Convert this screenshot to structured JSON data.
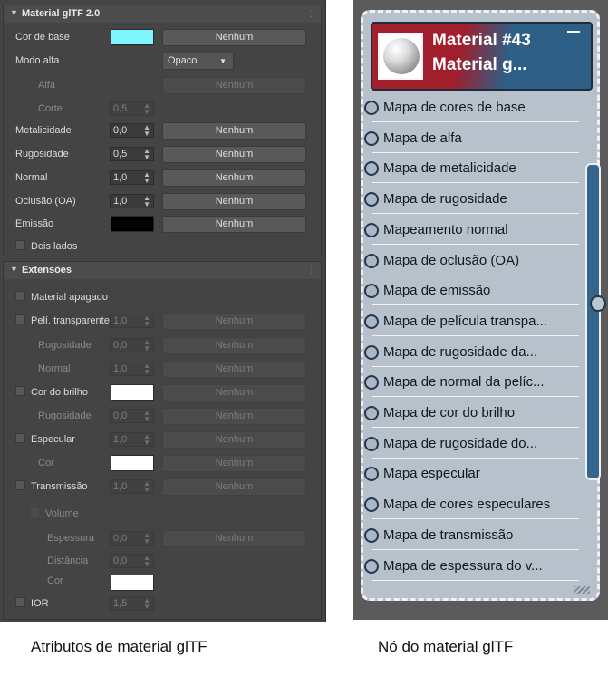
{
  "panel": {
    "gltf_section": {
      "title": "Material glTF 2.0",
      "rows": {
        "base_color": {
          "label": "Cor de base",
          "color": "#7ff6ff",
          "map": "Nenhum"
        },
        "alpha_mode": {
          "label": "Modo alfa",
          "value": "Opaco"
        },
        "alpha": {
          "label": "Alfa",
          "map": "Nenhum"
        },
        "cutoff": {
          "label": "Corte",
          "value": "0,5"
        },
        "metalness": {
          "label": "Metalicidade",
          "value": "0,0",
          "map": "Nenhum"
        },
        "roughness": {
          "label": "Rugosidade",
          "value": "0,5",
          "map": "Nenhum"
        },
        "normal": {
          "label": "Normal",
          "value": "1,0",
          "map": "Nenhum"
        },
        "occlusion": {
          "label": "Oclusão (OA)",
          "value": "1,0",
          "map": "Nenhum"
        },
        "emission": {
          "label": "Emissão",
          "color": "#000000",
          "map": "Nenhum"
        },
        "double_sided": {
          "label": "Dois lados"
        }
      }
    },
    "extensions_section": {
      "title": "Extensões",
      "rows": {
        "unlit": {
          "label": "Material apagado"
        },
        "clearcoat": {
          "label": "Pelí. transparente",
          "value": "1,0",
          "map": "Nenhum"
        },
        "clearcoat_roughness": {
          "label": "Rugosidade",
          "value": "0,0",
          "map": "Nenhum"
        },
        "clearcoat_normal": {
          "label": "Normal",
          "value": "1,0",
          "map": "Nenhum"
        },
        "sheen_color": {
          "label": "Cor do brilho",
          "color": "#ffffff",
          "map": "Nenhum"
        },
        "sheen_roughness": {
          "label": "Rugosidade",
          "value": "0,0",
          "map": "Nenhum"
        },
        "specular": {
          "label": "Especular",
          "value": "1,0",
          "map": "Nenhum"
        },
        "specular_color": {
          "label": "Cor",
          "color": "#ffffff",
          "map": "Nenhum"
        },
        "transmission": {
          "label": "Transmissão",
          "value": "1,0",
          "map": "Nenhum"
        },
        "volume": {
          "label": "Volume"
        },
        "thickness": {
          "label": "Espessura",
          "value": "0,0",
          "map": "Nenhum"
        },
        "distance": {
          "label": "Distância",
          "value": "0,0"
        },
        "volume_color": {
          "label": "Cor",
          "color": "#ffffff"
        },
        "ior": {
          "label": "IOR",
          "value": "1,5"
        }
      }
    }
  },
  "node": {
    "title_line1": "Material #43",
    "title_line2": "Material g...",
    "header_colors": {
      "left": "#a11e2c",
      "right": "#2e5f86"
    },
    "sockets": [
      "Mapa de cores de base",
      "Mapa de alfa",
      "Mapa de metalicidade",
      "Mapa de rugosidade",
      "Mapeamento normal",
      "Mapa de oclusão (OA)",
      "Mapa de emissão",
      "Mapa de película transpa...",
      "Mapa de rugosidade da...",
      "Mapa de normal da pelíc...",
      "Mapa de cor do brilho",
      "Mapa de rugosidade do...",
      "Mapa especular",
      "Mapa de cores especulares",
      "Mapa de transmissão",
      "Mapa de espessura do v..."
    ]
  },
  "captions": {
    "left": "Atributos de material glTF",
    "right": "Nó do material glTF"
  }
}
